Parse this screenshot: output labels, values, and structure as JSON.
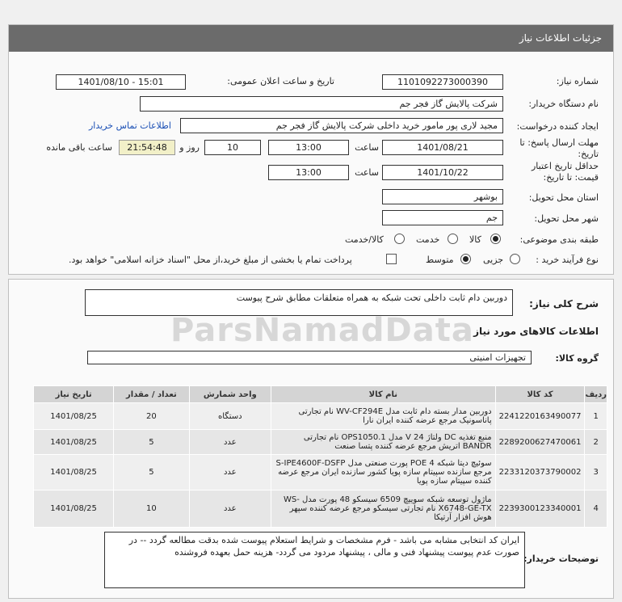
{
  "header": {
    "title": "جزئیات اطلاعات نیاز"
  },
  "fields": {
    "need_number_label": "شماره نیاز:",
    "need_number": "1101092273000390",
    "announce_label": "تاریخ و ساعت اعلان عمومی:",
    "announce_value": "1401/08/10 - 15:01",
    "buyer_label": "نام دستگاه خریدار:",
    "buyer_value": "شرکت پالایش گاز فجر جم",
    "creator_label": "ایجاد کننده درخواست:",
    "creator_value": "مجید  لاری پور مامور خرید داخلی شرکت پالایش گاز فجر جم",
    "contact_link": "اطلاعات تماس خریدار",
    "reply_label": "مهلت ارسال پاسخ: تا",
    "reply_label2": "تاریخ:",
    "reply_date": "1401/08/21",
    "time_label": "ساعت",
    "reply_time": "13:00",
    "days_value": "10",
    "days_label": "روز و",
    "remaining_value": "21:54:48",
    "remaining_label": "ساعت باقی مانده",
    "validity_label": "حداقل تاریخ اعتبار",
    "validity_label2": "قیمت: تا تاریخ:",
    "validity_date": "1401/10/22",
    "validity_time": "13:00",
    "province_label": "استان محل تحویل:",
    "province_value": "بوشهر",
    "city_label": "شهر محل تحویل:",
    "city_value": "جم",
    "category_label": "طبقه بندی موضوعی:",
    "category_options": [
      "کالا",
      "خدمت",
      "کالا/خدمت"
    ],
    "process_label": "نوع فرآیند خرید :",
    "process_options": [
      "جزیی",
      "متوسط"
    ],
    "payment_text": "پرداخت تمام یا بخشی از مبلغ خرید،از محل \"اسناد خزانه اسلامی\" خواهد بود."
  },
  "description": {
    "label": "شرح کلی نیاز:",
    "value": "دوربین دام ثابت داخلی تحت شبکه به همراه متعلقات مطابق شرح پیوست"
  },
  "goods": {
    "section_title": "اطلاعات کالاهای مورد نیاز",
    "group_label": "گروه کالا:",
    "group_value": "تجهیزات امنیتی",
    "columns": [
      "ردیف",
      "کد کالا",
      "نام کالا",
      "واحد شمارش",
      "تعداد / مقدار",
      "تاریخ نیاز"
    ],
    "rows": [
      {
        "idx": "1",
        "code": "2241220163490077",
        "name": "دوربین مدار بسته دام ثابت مدل WV-CF294E نام تجارتی پاناسونیک مرجع عرضه کننده ایران نارا",
        "unit": "دستگاه",
        "qty": "20",
        "date": "1401/08/25"
      },
      {
        "idx": "2",
        "code": "2289200627470061",
        "name": "منبع تغذیه DC ولتاژ 24 V مدل OPS1050.1 نام تجارتی BANDR اتریش مرجع عرضه کننده پتسا صنعت",
        "unit": "عدد",
        "qty": "5",
        "date": "1401/08/25"
      },
      {
        "idx": "3",
        "code": "2233120373790002",
        "name": "سوئیچ دیتا شبکه 4 POE پورت صنعتی مدل S-IPE4600F-DSFP مرجع سازنده سپیتام سازه پویا کشور سازنده ایران مرجع عرضه کننده سپیتام سازه پویا",
        "unit": "عدد",
        "qty": "5",
        "date": "1401/08/25"
      },
      {
        "idx": "4",
        "code": "2239300123340001",
        "name": "ماژول توسعه شبکه سوییچ 6509 سیسکو 48 پورت مدل WS-X6748-GE-TX نام تجارتی سیسکو مرجع عرضه کننده سپهر هوش افزار آرتیکا",
        "unit": "عدد",
        "qty": "10",
        "date": "1401/08/25"
      }
    ]
  },
  "notes": {
    "label": "توضیحات خریدار:",
    "value": "ایران کد انتخابی مشابه می باشد  -  فرم مشخصات و شرایط استعلام  پیوست شده بدقت مطالعه گردد -- در صورت عدم پیوست پیشنهاد فنی و مالی ، پیشنهاد مردود می گردد- هزینه حمل بعهده فروشنده"
  },
  "watermark": "ParsNamadData"
}
